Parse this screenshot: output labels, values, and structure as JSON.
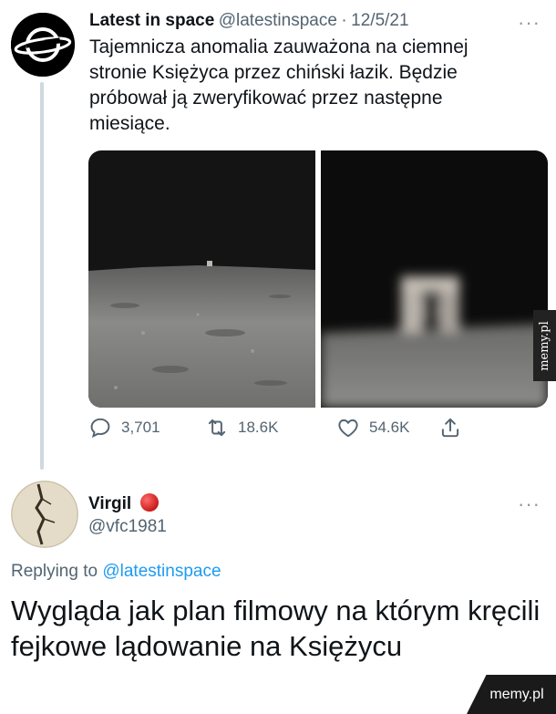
{
  "tweet": {
    "author": "Latest in space",
    "handle": "@latestinspace",
    "separator": "·",
    "date": "12/5/21",
    "text": "Tajemnicza anomalia zauważona na ciemnej stronie Księżyca przez chiński łazik. Będzie próbował ją zweryfikować przez następne miesiące.",
    "more_label": "···",
    "actions": {
      "replies": "3,701",
      "retweets": "18.6K",
      "likes": "54.6K"
    },
    "icons": [
      "reply-icon",
      "retweet-icon",
      "like-icon",
      "share-icon"
    ]
  },
  "reply": {
    "author": "Virgil",
    "handle": "@vfc1981",
    "more_label": "···",
    "replying_prefix": "Replying to",
    "replying_to": "@latestinspace",
    "text": "Wygląda jak plan filmowy na którym kręcili fejkowe lądowanie na Księżycu"
  },
  "watermarks": {
    "side": "memy.pl",
    "corner": "memy.pl"
  },
  "colors": {
    "link": "#1d9bf0",
    "secondary_text": "#536471",
    "thread_line": "#cfd9de",
    "badge_red": "#d61f1f"
  }
}
